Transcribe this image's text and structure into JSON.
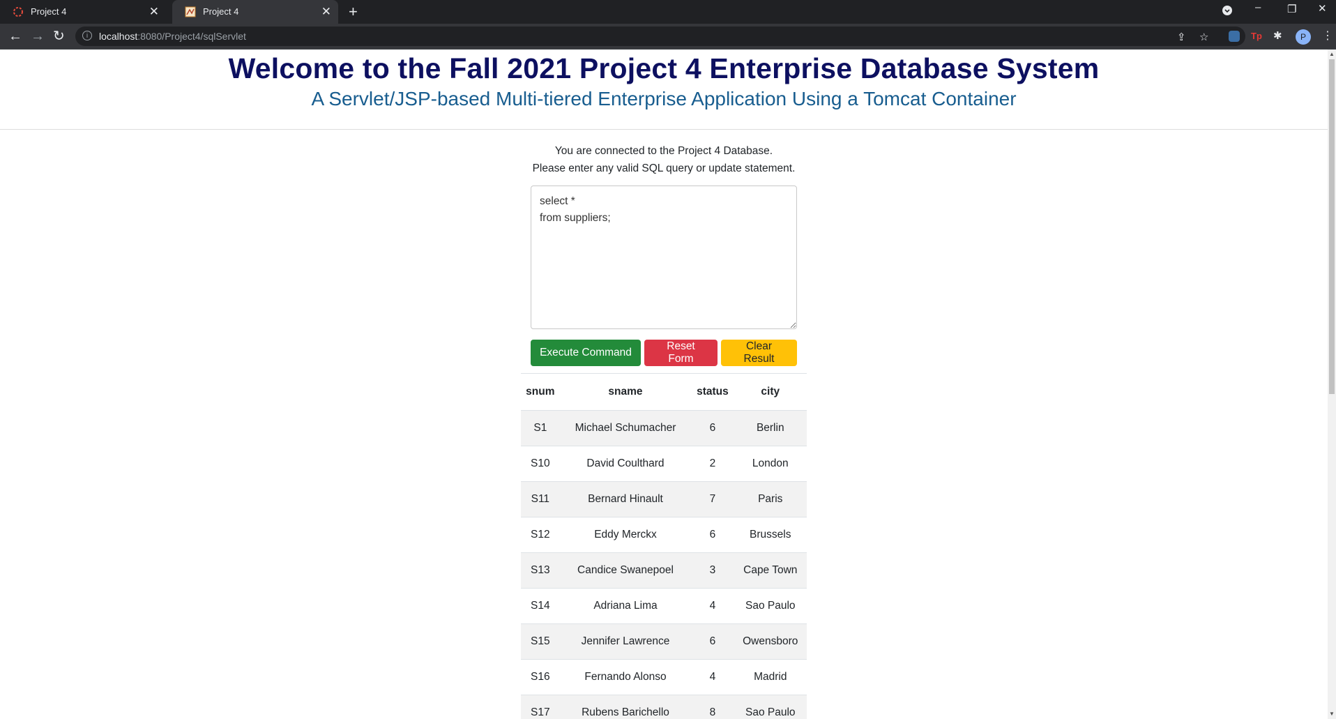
{
  "browser": {
    "tabs": [
      {
        "title": "Project 4",
        "active": false
      },
      {
        "title": "Project 4",
        "active": true
      }
    ],
    "url_host": "localhost",
    "url_rest": ":8080/Project4/sqlServlet",
    "profile_initial": "P"
  },
  "page": {
    "title": "Welcome to the Fall 2021 Project 4 Enterprise Database System",
    "subtitle": "A Servlet/JSP-based Multi-tiered Enterprise Application Using a Tomcat Container",
    "intro_line1": "You are connected to the Project 4 Database.",
    "intro_line2": "Please enter any valid SQL query or update statement.",
    "sql_text": "select *\nfrom suppliers;",
    "buttons": {
      "execute": "Execute Command",
      "reset": "Reset Form",
      "clear": "Clear Result"
    },
    "colors": {
      "title": "#0d1060",
      "subtitle": "#185d8f",
      "execute": "#238b3a",
      "reset": "#dc3545",
      "clear": "#ffc107"
    }
  },
  "results": {
    "headers": [
      "snum",
      "sname",
      "status",
      "city"
    ],
    "rows": [
      [
        "S1",
        "Michael Schumacher",
        "6",
        "Berlin"
      ],
      [
        "S10",
        "David Coulthard",
        "2",
        "London"
      ],
      [
        "S11",
        "Bernard Hinault",
        "7",
        "Paris"
      ],
      [
        "S12",
        "Eddy Merckx",
        "6",
        "Brussels"
      ],
      [
        "S13",
        "Candice Swanepoel",
        "3",
        "Cape Town"
      ],
      [
        "S14",
        "Adriana Lima",
        "4",
        "Sao Paulo"
      ],
      [
        "S15",
        "Jennifer Lawrence",
        "6",
        "Owensboro"
      ],
      [
        "S16",
        "Fernando Alonso",
        "4",
        "Madrid"
      ],
      [
        "S17",
        "Rubens Barichello",
        "8",
        "Sao Paulo"
      ]
    ]
  }
}
